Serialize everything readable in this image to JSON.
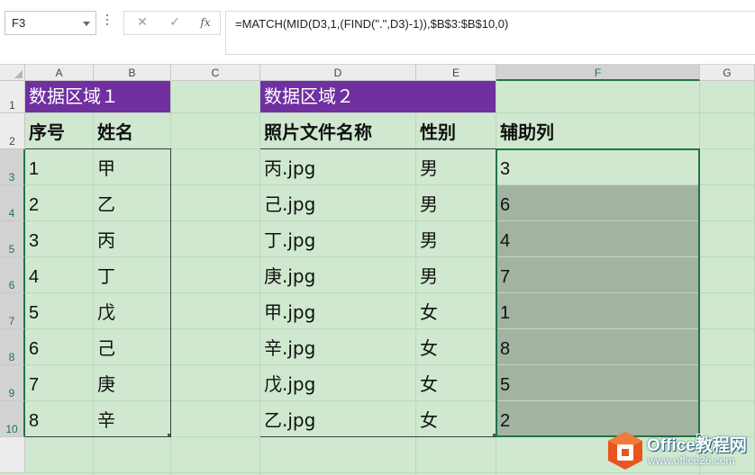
{
  "formula_bar": {
    "name_box": "F3",
    "cancel_icon": "✕",
    "enter_icon": "✓",
    "fx_label": "fx",
    "formula": "=MATCH(MID(D3,1,(FIND(\".\",D3)-1)),$B$3:$B$10,0)"
  },
  "columns": [
    "A",
    "B",
    "C",
    "D",
    "E",
    "F",
    "G"
  ],
  "rows": [
    "1",
    "2",
    "3",
    "4",
    "5",
    "6",
    "7",
    "8",
    "9",
    "10"
  ],
  "selected_column": "F",
  "selected_range": "F3:F10",
  "colors": {
    "header_fill": "#7030a0",
    "sheet_fill": "#cfe8cf",
    "selection_border": "#217346",
    "selection_fill": "#a2b3a2"
  },
  "table1": {
    "title": "数据区域１",
    "headers": [
      "序号",
      "姓名"
    ],
    "rows": [
      [
        "1",
        "甲"
      ],
      [
        "2",
        "乙"
      ],
      [
        "3",
        "丙"
      ],
      [
        "4",
        "丁"
      ],
      [
        "5",
        "戊"
      ],
      [
        "6",
        "己"
      ],
      [
        "7",
        "庚"
      ],
      [
        "8",
        "辛"
      ]
    ]
  },
  "table2": {
    "title": "数据区域２",
    "headers": [
      "照片文件名称",
      "性别"
    ],
    "rows": [
      [
        "丙.jpg",
        "男"
      ],
      [
        "己.jpg",
        "男"
      ],
      [
        "丁.jpg",
        "男"
      ],
      [
        "庚.jpg",
        "男"
      ],
      [
        "甲.jpg",
        "女"
      ],
      [
        "辛.jpg",
        "女"
      ],
      [
        "戊.jpg",
        "女"
      ],
      [
        "乙.jpg",
        "女"
      ]
    ]
  },
  "helper": {
    "header": "辅助列",
    "values": [
      "3",
      "6",
      "4",
      "7",
      "1",
      "8",
      "5",
      "2"
    ]
  },
  "watermark": {
    "icon": "office-logo-icon",
    "title": "Office教程网",
    "url": "www.office26.com"
  }
}
